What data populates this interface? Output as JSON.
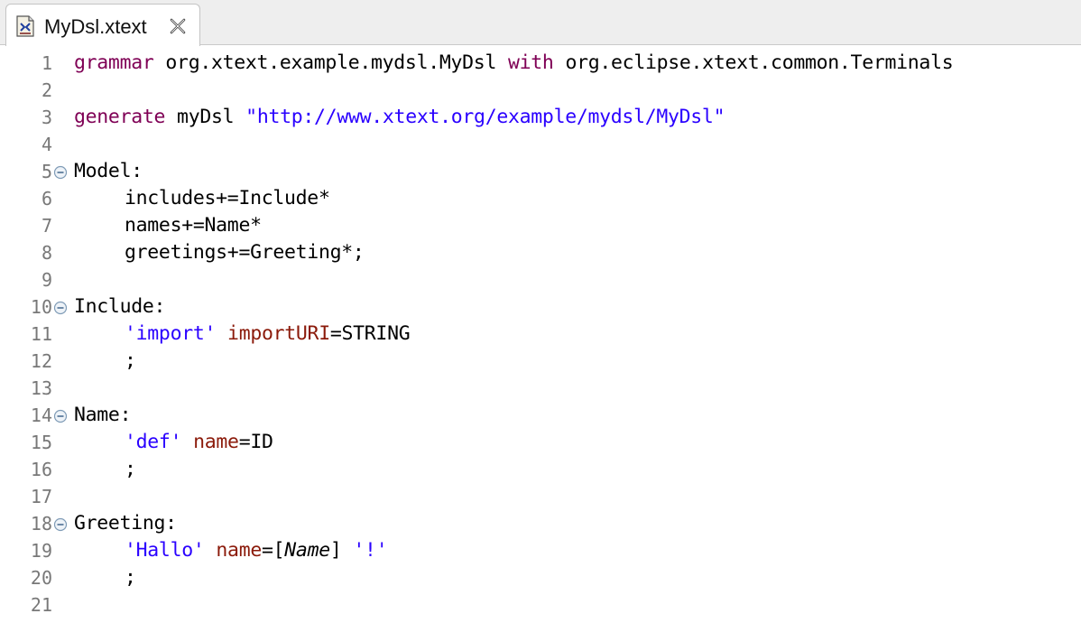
{
  "tab": {
    "title": "MyDsl.xtext",
    "icon": "xtext-file-icon",
    "close_icon": "close-icon"
  },
  "colors": {
    "keyword": "#7f0055",
    "string": "#2a00ff",
    "feature": "#8b1a0a",
    "line_number": "#787878"
  },
  "editor": {
    "lines": [
      {
        "n": "1",
        "fold": false,
        "tokens": [
          [
            "kw",
            "grammar"
          ],
          [
            "",
            "org.xtext.example.mydsl.MyDsl"
          ],
          [
            "kw",
            "with"
          ],
          [
            "",
            "org.eclipse.xtext.common.Terminals"
          ]
        ]
      },
      {
        "n": "2",
        "fold": false,
        "tokens": []
      },
      {
        "n": "3",
        "fold": false,
        "tokens": [
          [
            "kw",
            "generate"
          ],
          [
            "",
            "myDsl"
          ],
          [
            "str",
            "\"http://www.xtext.org/example/mydsl/MyDsl\""
          ]
        ]
      },
      {
        "n": "4",
        "fold": false,
        "tokens": []
      },
      {
        "n": "5",
        "fold": true,
        "tokens": [
          [
            "",
            "Model:"
          ]
        ]
      },
      {
        "n": "6",
        "fold": false,
        "tokens": [
          [
            "",
            "includes+=Include*"
          ]
        ]
      },
      {
        "n": "7",
        "fold": false,
        "tokens": [
          [
            "",
            "names+=Name*"
          ]
        ]
      },
      {
        "n": "8",
        "fold": false,
        "tokens": [
          [
            "",
            "greetings+=Greeting*;"
          ]
        ]
      },
      {
        "n": "9",
        "fold": false,
        "tokens": []
      },
      {
        "n": "10",
        "fold": true,
        "tokens": [
          [
            "",
            "Include:"
          ]
        ]
      },
      {
        "n": "11",
        "fold": false,
        "tokens": [
          [
            "str",
            "'import'"
          ],
          [
            "feat",
            "importURI"
          ],
          [
            "",
            "=STRING"
          ]
        ]
      },
      {
        "n": "12",
        "fold": false,
        "tokens": [
          [
            "",
            ";"
          ]
        ]
      },
      {
        "n": "13",
        "fold": false,
        "tokens": []
      },
      {
        "n": "14",
        "fold": true,
        "tokens": [
          [
            "",
            "Name:"
          ]
        ]
      },
      {
        "n": "15",
        "fold": false,
        "tokens": [
          [
            "str",
            "'def'"
          ],
          [
            "feat",
            "name"
          ],
          [
            "",
            "=ID"
          ]
        ]
      },
      {
        "n": "16",
        "fold": false,
        "tokens": [
          [
            "",
            ";"
          ]
        ]
      },
      {
        "n": "17",
        "fold": false,
        "tokens": []
      },
      {
        "n": "18",
        "fold": true,
        "tokens": [
          [
            "",
            "Greeting:"
          ]
        ]
      },
      {
        "n": "19",
        "fold": false,
        "tokens": [
          [
            "str",
            "'Hallo'"
          ],
          [
            "feat",
            "name"
          ],
          [
            "",
            "=["
          ],
          [
            "ital",
            "Name"
          ],
          [
            "",
            "]"
          ],
          [
            "str",
            "'!'"
          ]
        ]
      },
      {
        "n": "20",
        "fold": false,
        "tokens": [
          [
            "",
            ";"
          ]
        ]
      },
      {
        "n": "21",
        "fold": false,
        "tokens": []
      }
    ]
  }
}
